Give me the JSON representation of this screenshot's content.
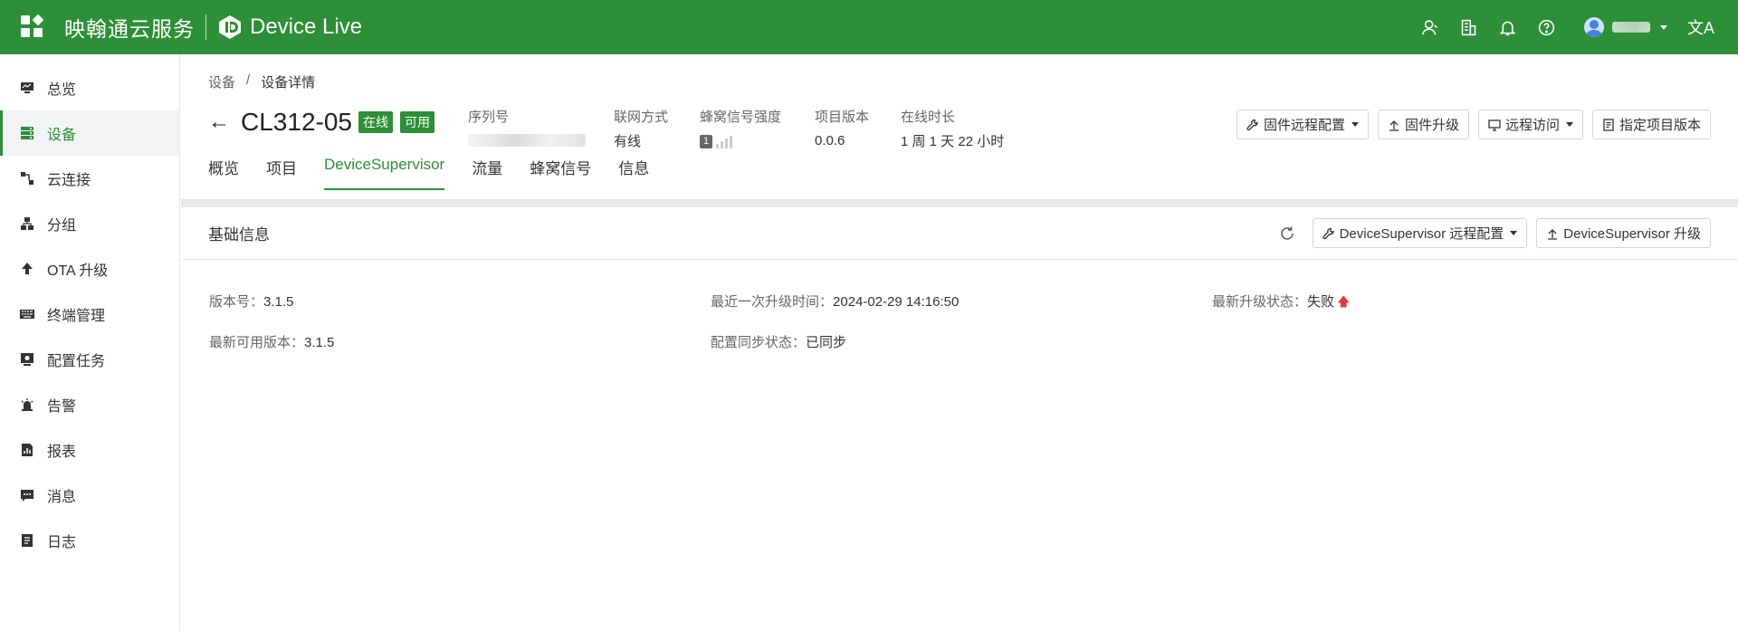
{
  "topbar": {
    "brand": "映翰通云服务",
    "product": "Device Live",
    "lang_label": "文A"
  },
  "sidebar": {
    "items": [
      {
        "label": "总览",
        "icon": "monitor-icon"
      },
      {
        "label": "设备",
        "icon": "device-list-icon"
      },
      {
        "label": "云连接",
        "icon": "cloud-connect-icon"
      },
      {
        "label": "分组",
        "icon": "group-icon"
      },
      {
        "label": "OTA 升级",
        "icon": "upload-arrow-icon"
      },
      {
        "label": "终端管理",
        "icon": "keyboard-icon"
      },
      {
        "label": "配置任务",
        "icon": "config-task-icon"
      },
      {
        "label": "告警",
        "icon": "alarm-icon"
      },
      {
        "label": "报表",
        "icon": "report-icon"
      },
      {
        "label": "消息",
        "icon": "message-icon"
      },
      {
        "label": "日志",
        "icon": "log-icon"
      }
    ],
    "active": "设备"
  },
  "breadcrumb": {
    "root": "设备",
    "sep": "/",
    "current": "设备详情"
  },
  "device": {
    "name": "CL312-05",
    "status_tag": "在线",
    "avail_tag": "可用"
  },
  "meta": {
    "serial_label": "序列号",
    "network_label": "联网方式",
    "network_value": "有线",
    "signal_label": "蜂窝信号强度",
    "signal_level": "1",
    "project_version_label": "项目版本",
    "project_version_value": "0.0.6",
    "uptime_label": "在线时长",
    "uptime_value": "1 周 1 天 22 小时"
  },
  "actions": {
    "firmware_config": "固件远程配置",
    "firmware_upgrade": "固件升级",
    "remote_access": "远程访问",
    "assign_version": "指定项目版本"
  },
  "tabs": [
    "概览",
    "项目",
    "DeviceSupervisor",
    "流量",
    "蜂窝信号",
    "信息"
  ],
  "active_tab": "DeviceSupervisor",
  "card": {
    "title": "基础信息",
    "remote_config_btn": "DeviceSupervisor 远程配置",
    "upgrade_btn": "DeviceSupervisor 升级"
  },
  "info": {
    "version_label": "版本号：",
    "version_value": "3.1.5",
    "last_upgrade_label": "最近一次升级时间：",
    "last_upgrade_value": "2024-02-29 14:16:50",
    "upgrade_status_label": "最新升级状态：",
    "upgrade_status_value": "失败",
    "latest_available_label": "最新可用版本：",
    "latest_available_value": "3.1.5",
    "sync_status_label": "配置同步状态：",
    "sync_status_value": "已同步"
  },
  "colors": {
    "brand_green": "#2d8f37",
    "fail_red": "#e23c3c"
  }
}
